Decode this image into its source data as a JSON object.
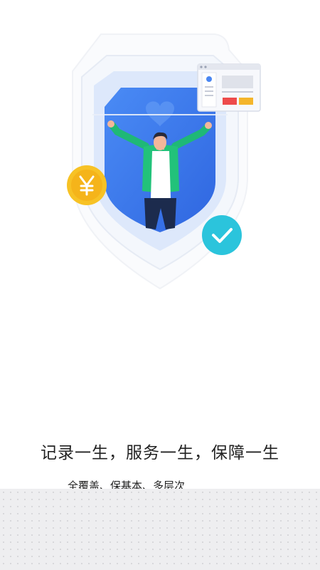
{
  "onboarding": {
    "tagline": "记录一生，服务一生，保障一生",
    "subline": "全覆盖、保基本、多层次"
  },
  "icons": {
    "coin": "yen-coin-icon",
    "check": "check-circle-icon",
    "card": "profile-card-icon",
    "shield": "shield-icon"
  },
  "colors": {
    "shield_blue": "#3f7ef2",
    "check_cyan": "#2bc4dc",
    "coin_gold": "#f7c225",
    "jacket_green": "#22c27a"
  }
}
